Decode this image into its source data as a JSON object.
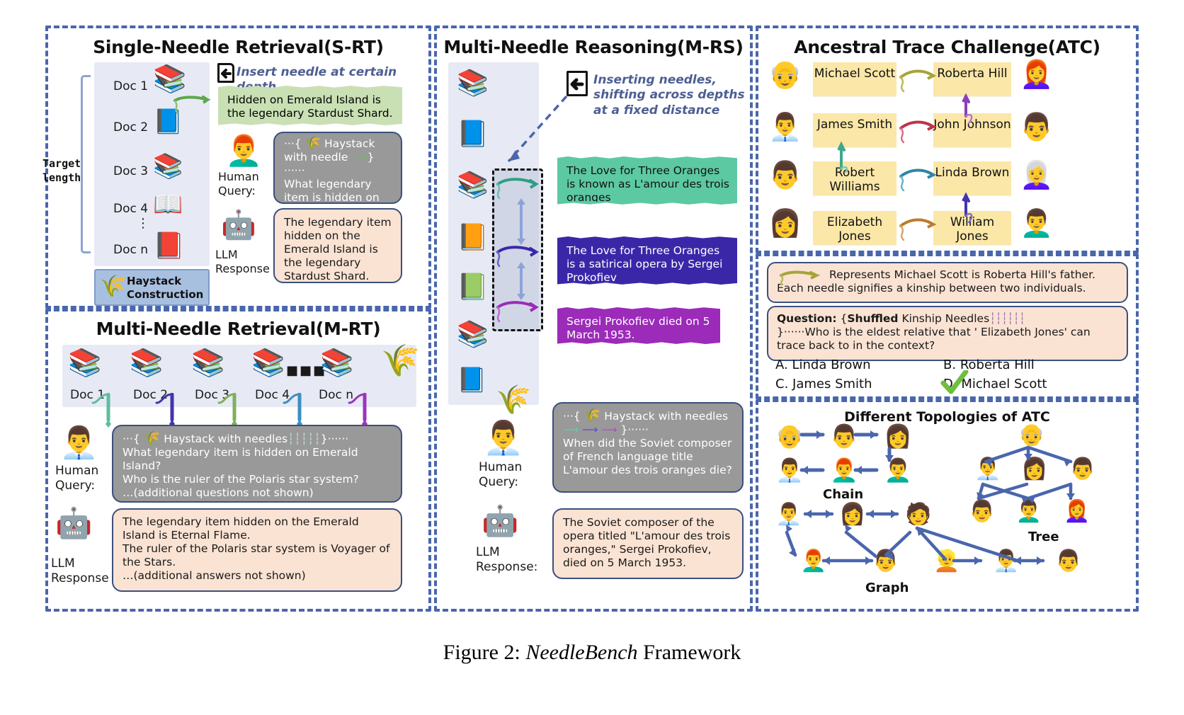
{
  "figure": {
    "caption_prefix": "Figure 2: ",
    "caption_name": "NeedleBench",
    "caption_suffix": " Framework"
  },
  "panels": {
    "srt": {
      "title": "Single-Needle Retrieval(S-RT)",
      "target_length_label": "Target\nlength",
      "docs": [
        "Doc 1",
        "Doc 2",
        "Doc 3",
        "Doc 4",
        "⋮",
        "Doc n"
      ],
      "haystack_label": "Haystack\nConstruction",
      "insert_note": "Insert needle at certain depth",
      "needle_text": "Hidden on Emerald Island is the legendary Stardust Shard.",
      "human_label": "Human\nQuery:",
      "llm_label": "LLM\nResponse",
      "query_prefix": "···{",
      "query_haystack": "Haystack with needle",
      "query_suffix": "}······",
      "query_text": "What legendary item is hidden on Emerald Island?",
      "response_text": "The legendary item hidden on the Emerald Island is the legendary Stardust Shard."
    },
    "mrt": {
      "title": "Multi-Needle Retrieval(M-RT)",
      "docs": [
        "Doc 1",
        "Doc 2",
        "Doc 3",
        "Doc 4",
        "Doc n"
      ],
      "human_label": "Human\nQuery:",
      "llm_label": "LLM\nResponse",
      "query_prefix": "···{",
      "query_haystack": "Haystack with needles",
      "query_suffix": "}······",
      "query_line1": "What legendary item is hidden on Emerald Island?",
      "query_line2": "Who is the ruler of the Polaris star system?",
      "query_line3": "…(additional questions not shown)",
      "response_line1": "The legendary item hidden on the Emerald Island is Eternal Flame.",
      "response_line2": "The ruler of the Polaris star system is Voyager of the Stars.",
      "response_line3": "…(additional answers not shown)"
    },
    "mrs": {
      "title": "Multi-Needle Reasoning(M-RS)",
      "insert_note": "Inserting needles, shifting across depths at a fixed distance",
      "fact1": "The Love for Three Oranges is known as L'amour des trois oranges",
      "fact2": "The Love for Three Oranges is a satirical opera by Sergei Prokofiev",
      "fact3": "Sergei Prokofiev died on 5 March 1953.",
      "human_label": "Human\nQuery:",
      "llm_label": "LLM\nResponse:",
      "query_prefix": "···{",
      "query_haystack": "Haystack with needles",
      "query_suffix": "}······",
      "query_text": "When did the Soviet composer of French language title L'amour des trois oranges die?",
      "response_text": "The Soviet composer of the opera titled \"L'amour des trois oranges,\" Sergei Prokofiev, died on 5 March 1953."
    },
    "atc": {
      "title": "Ancestral Trace Challenge(ATC)",
      "names_left": [
        "Michael Scott",
        "James Smith",
        "Robert Williams",
        "Elizabeth Jones"
      ],
      "names_right": [
        "Roberta Hill",
        "John Johnson",
        "Linda Brown",
        "William Jones"
      ],
      "legend_text": "Represents Michael Scott is Roberta Hill's father. Each needle signifies a kinship between two individuals.",
      "question_label": "Question:",
      "question_brace_open": "{",
      "question_shuffled": "Shuffled",
      "question_kinship": "Kinship Needles",
      "question_brace_close": "}······",
      "question_text": "Who is the eldest relative that ' Elizabeth Jones' can trace back to in the context?",
      "options": [
        {
          "key": "A.",
          "label": "Linda Brown",
          "correct": false
        },
        {
          "key": "B.",
          "label": "Roberta Hill",
          "correct": false
        },
        {
          "key": "C.",
          "label": "James Smith",
          "correct": false
        },
        {
          "key": "D.",
          "label": "Michael Scott",
          "correct": true
        }
      ],
      "check_glyph": "✔"
    },
    "topologies": {
      "title": "Different Topologies of ATC",
      "labels": [
        "Chain",
        "Tree",
        "Graph"
      ]
    }
  },
  "colors": {
    "panel_border": "#4a66ac",
    "haystack_bg": "#e7eaf4",
    "haystack_box": "#a8c0e0",
    "needle_green": "#c9e0b4",
    "fact_teal": "#5cc9a3",
    "fact_blue": "#3a27a8",
    "fact_purple": "#9b2bb8",
    "bubble_gray": "#999999",
    "bubble_peach": "#fae3d3",
    "namecard": "#fbe7a8",
    "arrow_blue": "#4a66ac",
    "check_green": "#63bf3a"
  },
  "icons": {
    "doc_insert": "document-arrow-icon",
    "haystack": "haystack-icon",
    "needle": "needle-icon",
    "human": "human-avatar-icon",
    "llm": "llm-robot-icon",
    "books": "books-icon",
    "person": "person-avatar-icon",
    "check": "check-icon"
  }
}
